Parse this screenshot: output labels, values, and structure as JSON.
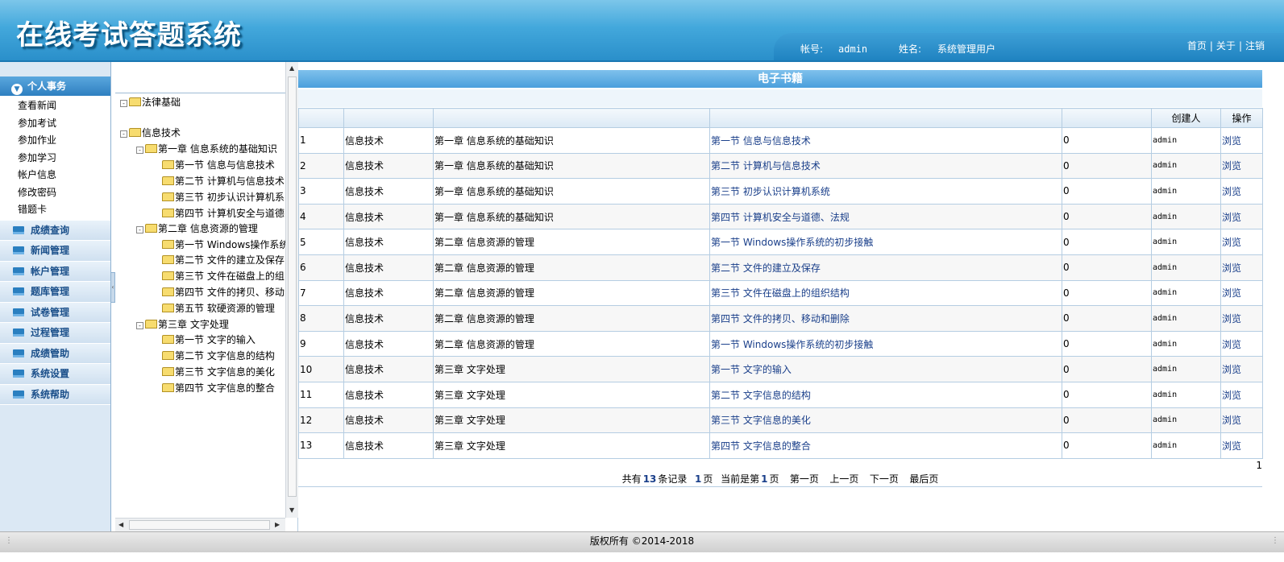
{
  "header": {
    "title": "在线考试答题系统",
    "account_label": "帐号:",
    "account_value": "admin",
    "name_label": "姓名:",
    "name_value": "系统管理用户",
    "links": [
      "首页",
      "关于",
      "注销"
    ],
    "separator": "|"
  },
  "sidebar": {
    "active_group": "个人事务",
    "active_items": [
      "查看新闻",
      "参加考试",
      "参加作业",
      "参加学习",
      "帐户信息",
      "修改密码",
      "错题卡"
    ],
    "groups": [
      "成绩查询",
      "新闻管理",
      "帐户管理",
      "题库管理",
      "试卷管理",
      "过程管理",
      "成绩管助",
      "系统设置",
      "系统帮助"
    ]
  },
  "tree": {
    "root1": "法律基础",
    "root2": "信息技术",
    "chapters": [
      {
        "label": "第一章 信息系统的基础知识",
        "sections": [
          "第一节 信息与信息技术",
          "第二节 计算机与信息技术",
          "第三节 初步认识计算机系",
          "第四节 计算机安全与道德"
        ]
      },
      {
        "label": "第二章 信息资源的管理",
        "sections": [
          "第一节 Windows操作系统的",
          "第二节 文件的建立及保存",
          "第三节 文件在磁盘上的组",
          "第四节 文件的拷贝、移动",
          "第五节 软硬资源的管理"
        ]
      },
      {
        "label": "第三章 文字处理",
        "sections": [
          "第一节 文字的输入",
          "第二节 文字信息的结构",
          "第三节 文字信息的美化",
          "第四节 文字信息的整合"
        ]
      }
    ]
  },
  "main": {
    "title": "电子书籍",
    "columns": [
      "",
      "",
      "",
      "",
      "",
      "创建人",
      "操作"
    ],
    "rows": [
      {
        "id": "1",
        "subject": "信息技术",
        "chapter": "第一章 信息系统的基础知识",
        "section": "第一节 信息与信息技术",
        "count": "0",
        "creator": "admin",
        "action": "浏览"
      },
      {
        "id": "2",
        "subject": "信息技术",
        "chapter": "第一章 信息系统的基础知识",
        "section": "第二节 计算机与信息技术",
        "count": "0",
        "creator": "admin",
        "action": "浏览"
      },
      {
        "id": "3",
        "subject": "信息技术",
        "chapter": "第一章 信息系统的基础知识",
        "section": "第三节 初步认识计算机系统",
        "count": "0",
        "creator": "admin",
        "action": "浏览"
      },
      {
        "id": "4",
        "subject": "信息技术",
        "chapter": "第一章 信息系统的基础知识",
        "section": "第四节 计算机安全与道德、法规",
        "count": "0",
        "creator": "admin",
        "action": "浏览"
      },
      {
        "id": "5",
        "subject": "信息技术",
        "chapter": "第二章 信息资源的管理",
        "section": "第一节 Windows操作系统的初步接触",
        "count": "0",
        "creator": "admin",
        "action": "浏览"
      },
      {
        "id": "6",
        "subject": "信息技术",
        "chapter": "第二章 信息资源的管理",
        "section": "第二节 文件的建立及保存",
        "count": "0",
        "creator": "admin",
        "action": "浏览"
      },
      {
        "id": "7",
        "subject": "信息技术",
        "chapter": "第二章 信息资源的管理",
        "section": "第三节 文件在磁盘上的组织结构",
        "count": "0",
        "creator": "admin",
        "action": "浏览"
      },
      {
        "id": "8",
        "subject": "信息技术",
        "chapter": "第二章 信息资源的管理",
        "section": "第四节 文件的拷贝、移动和删除",
        "count": "0",
        "creator": "admin",
        "action": "浏览"
      },
      {
        "id": "9",
        "subject": "信息技术",
        "chapter": "第二章 信息资源的管理",
        "section": "第一节 Windows操作系统的初步接触",
        "count": "0",
        "creator": "admin",
        "action": "浏览"
      },
      {
        "id": "10",
        "subject": "信息技术",
        "chapter": "第三章 文字处理",
        "section": "第一节 文字的输入",
        "count": "0",
        "creator": "admin",
        "action": "浏览"
      },
      {
        "id": "11",
        "subject": "信息技术",
        "chapter": "第三章 文字处理",
        "section": "第二节 文字信息的结构",
        "count": "0",
        "creator": "admin",
        "action": "浏览"
      },
      {
        "id": "12",
        "subject": "信息技术",
        "chapter": "第三章 文字处理",
        "section": "第三节 文字信息的美化",
        "count": "0",
        "creator": "admin",
        "action": "浏览"
      },
      {
        "id": "13",
        "subject": "信息技术",
        "chapter": "第三章 文字处理",
        "section": "第四节 文字信息的整合",
        "count": "0",
        "creator": "admin",
        "action": "浏览"
      }
    ],
    "page_number": "1",
    "pager": {
      "total_prefix": "共有",
      "total_count": "13",
      "total_suffix": "条记录",
      "pages_count": "1",
      "pages_suffix": "页",
      "current_prefix": "当前是第",
      "current_page": "1",
      "current_suffix": "页",
      "first": "第一页",
      "prev": "上一页",
      "next": "下一页",
      "last": "最后页"
    }
  },
  "footer": {
    "copyright": "版权所有 ©2014-2018"
  }
}
